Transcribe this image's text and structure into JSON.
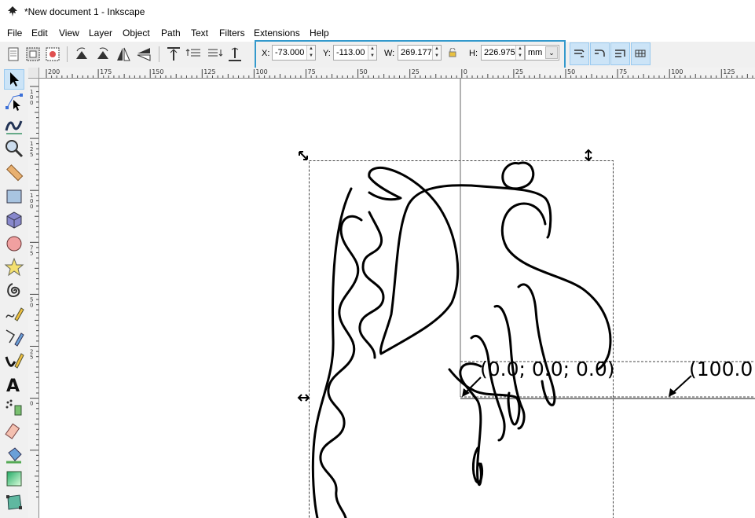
{
  "window": {
    "title": "*New document 1 - Inkscape"
  },
  "menubar": {
    "items": [
      {
        "label": "File"
      },
      {
        "label": "Edit"
      },
      {
        "label": "View"
      },
      {
        "label": "Layer"
      },
      {
        "label": "Object"
      },
      {
        "label": "Path"
      },
      {
        "label": "Text"
      },
      {
        "label": "Filters"
      },
      {
        "label": "Extensions"
      },
      {
        "label": "Help"
      }
    ]
  },
  "toolbar": {
    "x": {
      "label": "X:",
      "value": "-73.000"
    },
    "y": {
      "label": "Y:",
      "value": "-113.00"
    },
    "w": {
      "label": "W:",
      "value": "269.177"
    },
    "h": {
      "label": "H:",
      "value": "226.975"
    },
    "unit": "mm"
  },
  "rulers": {
    "horizontal_ticks": [
      "200",
      "175",
      "150",
      "125",
      "100",
      "75",
      "50",
      "25",
      "0",
      "25",
      "50",
      "75",
      "100",
      "125"
    ],
    "vertical_ticks": [
      "1 0 0",
      "1 2 5",
      "1 0 0",
      "7 5",
      "5 0",
      "2 5",
      "0"
    ]
  },
  "canvas": {
    "annotations": [
      "(0.0; 0.0; 0.0)",
      "(100.0"
    ]
  },
  "colors": {
    "accent": "#3399cc",
    "selected": "#cce4f7"
  }
}
